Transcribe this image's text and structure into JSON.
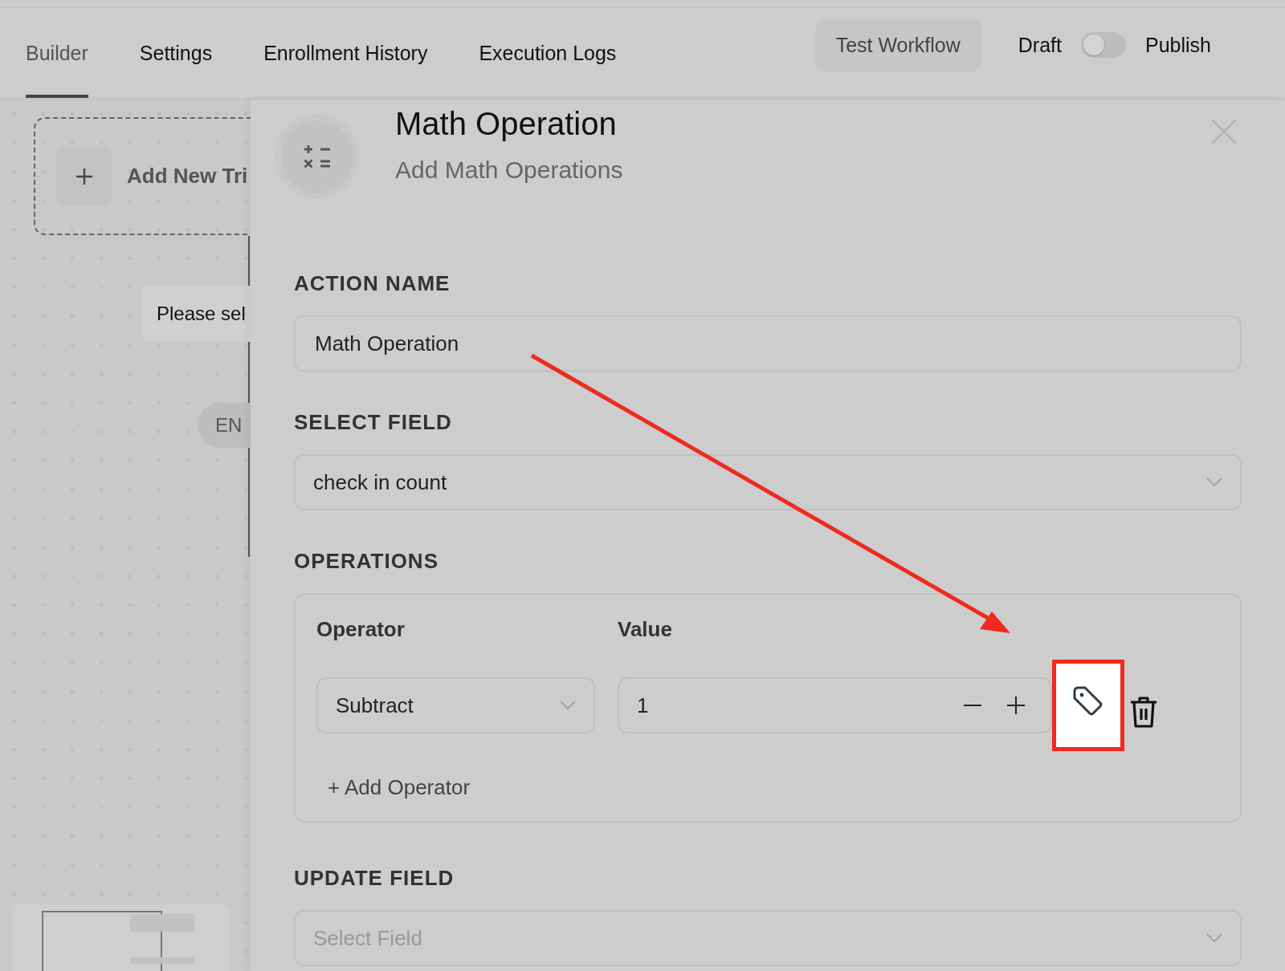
{
  "tabs": [
    {
      "label": "Builder",
      "selected": true
    },
    {
      "label": "Settings",
      "selected": false
    },
    {
      "label": "Enrollment History",
      "selected": false
    },
    {
      "label": "Execution Logs",
      "selected": false
    }
  ],
  "header": {
    "test_button": "Test Workflow",
    "draft_label": "Draft",
    "publish_toggle": {
      "on": false
    },
    "publish_label": "Publish"
  },
  "canvas": {
    "trigger_node": {
      "label": "Add New Tri"
    },
    "prompt_node": {
      "label": "Please sel"
    },
    "end_node": {
      "label": "EN"
    }
  },
  "panel": {
    "title": "Math Operation",
    "subtitle": "Add Math Operations",
    "action_name": {
      "label": "ACTION NAME",
      "value": "Math Operation"
    },
    "select_field": {
      "label": "SELECT FIELD",
      "value": "check in count"
    },
    "operations": {
      "label": "OPERATIONS",
      "operator_header": "Operator",
      "value_header": "Value",
      "rows": [
        {
          "operator": "Subtract",
          "value": "1",
          "tag_highlighted": true
        }
      ],
      "add_button": "+ Add Operator"
    },
    "update_field": {
      "label": "UPDATE FIELD",
      "placeholder": "Select Field"
    }
  }
}
